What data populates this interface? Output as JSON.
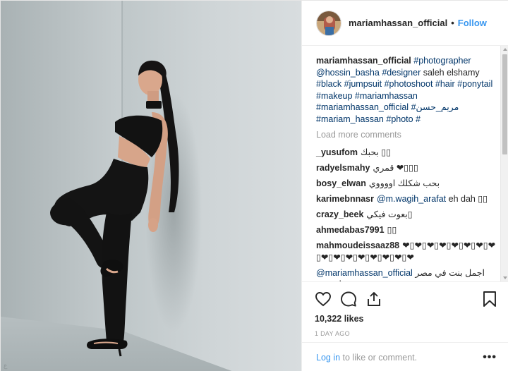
{
  "header": {
    "username": "mariamhassan_official",
    "separator": "•",
    "follow_label": "Follow"
  },
  "caption": {
    "username": "mariamhassan_official",
    "tags": [
      {
        "text": "#photographer",
        "tag": true
      },
      {
        "text": "@hossin_basha",
        "tag": true
      },
      {
        "text": "#designer",
        "tag": true
      },
      {
        "text": "saleh elshamy",
        "tag": false
      },
      {
        "text": "#black",
        "tag": true
      },
      {
        "text": "#jumpsuit",
        "tag": true
      },
      {
        "text": "#photoshoot",
        "tag": true
      },
      {
        "text": "#hair",
        "tag": true
      },
      {
        "text": "#ponytail",
        "tag": true
      },
      {
        "text": "#makeup",
        "tag": true
      },
      {
        "text": "#mariamhassan",
        "tag": true
      },
      {
        "text": "#mariamhassan_official",
        "tag": true
      },
      {
        "text": "#مريم_حسن",
        "tag": true
      },
      {
        "text": "#mariam_hassan",
        "tag": true
      },
      {
        "text": "#photo",
        "tag": true
      },
      {
        "text": "#",
        "tag": true
      }
    ]
  },
  "load_more_label": "Load more comments",
  "comments": [
    {
      "user": "_yusufom",
      "mention": "",
      "text": "بحبك ▯▯"
    },
    {
      "user": "radyelsmahy",
      "mention": "",
      "text": "قمري ❤▯▯▯"
    },
    {
      "user": "bosy_elwan",
      "mention": "",
      "text": "بحب شكلك اووووي"
    },
    {
      "user": "karimebnnasr",
      "mention": "@m.wagih_arafat",
      "text": "eh dah ▯▯"
    },
    {
      "user": "crazy_beek",
      "mention": "",
      "text": "بعوت فيكي▯"
    },
    {
      "user": "ahmedabas7991",
      "mention": "",
      "text": "▯▯"
    },
    {
      "user": "mahmoudeissaaz88",
      "mention": "",
      "text": "❤▯❤▯❤▯❤▯❤▯❤▯❤▯❤▯❤▯❤▯❤▯❤▯❤▯❤▯❤▯❤"
    },
    {
      "user": "",
      "mention": "@mariamhassan_official",
      "text": "اجمل بنت في مصر بحبك قوي"
    }
  ],
  "actions": {
    "like_icon": "heart-icon",
    "comment_icon": "comment-bubble-icon",
    "share_icon": "share-icon",
    "save_icon": "bookmark-icon"
  },
  "likes_text": "10,322 likes",
  "timestamp": "1 DAY AGO",
  "footer": {
    "login_label": "Log in",
    "rest_text": " to like or comment.",
    "more_label": "•••"
  },
  "colors": {
    "accent": "#3897f0",
    "tag": "#003569",
    "muted": "#999999",
    "text": "#262626"
  }
}
